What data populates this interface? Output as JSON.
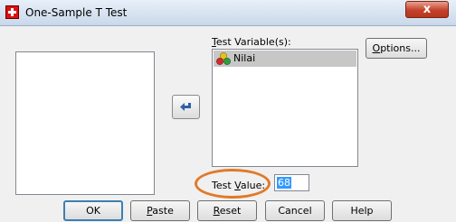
{
  "window": {
    "title": "One-Sample T Test",
    "close_label": "x"
  },
  "test_variables": {
    "label_prefix": "T",
    "label_rest": "est Variable(s):",
    "items": [
      {
        "label": "Nilai",
        "icon": "scale-variable-icon"
      }
    ]
  },
  "options_button": {
    "mnemonic": "O",
    "rest": "ptions..."
  },
  "move_button": {
    "icon": "arrow-left-icon"
  },
  "test_value": {
    "label_pre": "Test ",
    "label_mnemonic": "V",
    "label_post": "alue:",
    "value": "68"
  },
  "buttons": {
    "ok": "OK",
    "paste_mnemonic": "P",
    "paste_rest": "aste",
    "reset_mnemonic": "R",
    "reset_rest": "eset",
    "cancel": "Cancel",
    "help": "Help"
  },
  "colors": {
    "highlight_ring": "#e07a2a",
    "selection": "#3399ff"
  }
}
